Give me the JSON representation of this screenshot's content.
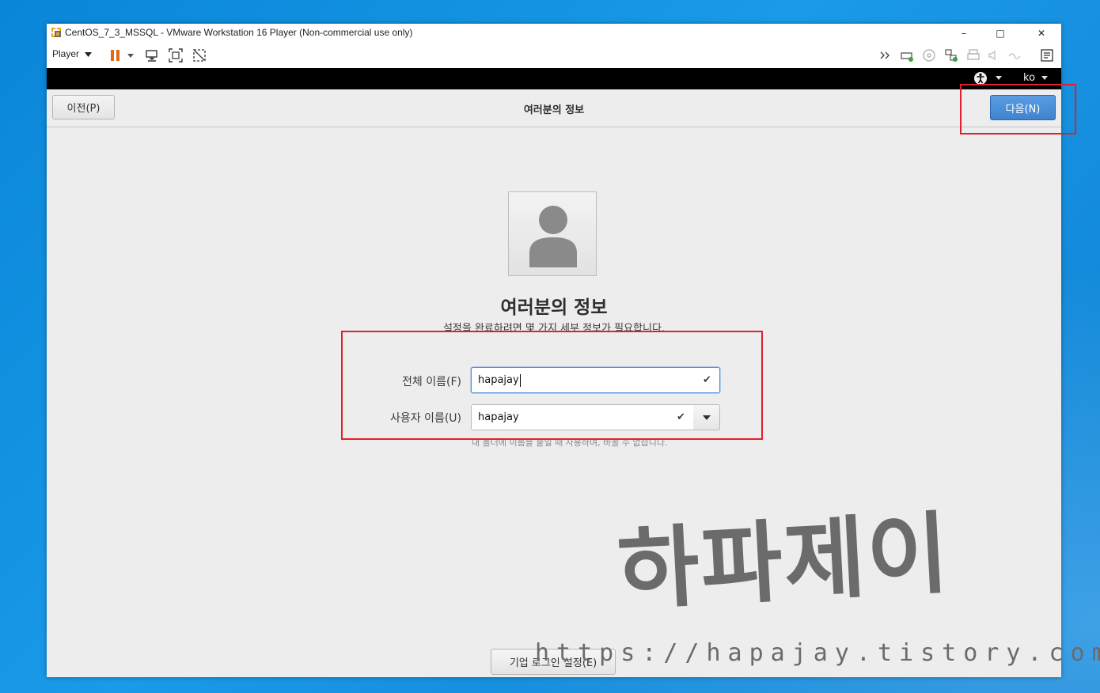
{
  "window": {
    "title": "CentOS_7_3_MSSQL - VMware Workstation 16 Player (Non-commercial use only)",
    "minimize": "–",
    "maximize": "□",
    "close": "✕"
  },
  "toolbar": {
    "player_menu": "Player"
  },
  "topbar": {
    "language": "ko"
  },
  "header": {
    "back_label": "이전(P)",
    "title": "여러분의 정보",
    "next_label": "다음(N)"
  },
  "main": {
    "title": "여러분의 정보",
    "subtitle": "설정을 완료하려면 몇 가지 세부 정보가 필요합니다.",
    "full_name_label": "전체 이름(F)",
    "full_name_value": "hapajay",
    "username_label": "사용자 이름(U)",
    "username_value": "hapajay",
    "username_hint": "내 폴더에 이름을 붙일 때 사용하며, 바꿀 수 없습니다.",
    "enterprise_label": "기업 로그인 설정(E)"
  },
  "watermark": {
    "name": "하파제이",
    "url": "https://hapajay.tistory.com/"
  },
  "colors": {
    "accent": "#4a90d9",
    "highlight": "#e0202a",
    "desktop": "#1a9ae8"
  }
}
